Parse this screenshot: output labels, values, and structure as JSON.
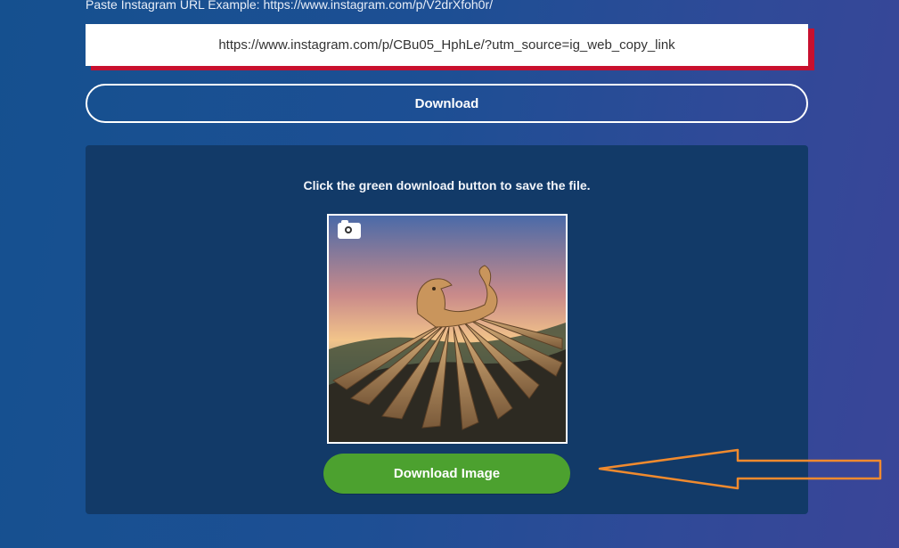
{
  "hint": "Paste Instagram URL Example: https://www.instagram.com/p/V2drXfoh0r/",
  "url_input": {
    "value": "https://www.instagram.com/p/CBu05_HphLe/?utm_source=ig_web_copy_link"
  },
  "download_button": "Download",
  "result": {
    "message": "Click the green download button to save the file.",
    "download_image_button": "Download Image"
  },
  "colors": {
    "accent_green": "#4ca12f",
    "input_shadow": "#c8102e",
    "panel": "#123a68",
    "arrow": "#f08a2e"
  }
}
